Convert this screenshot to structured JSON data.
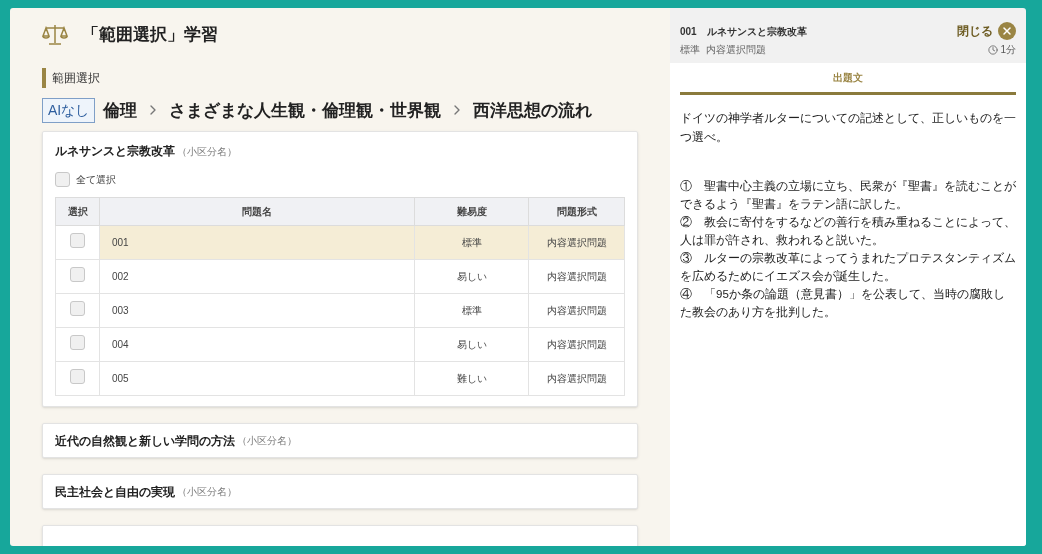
{
  "header": {
    "title": "「範囲選択」学習"
  },
  "section_label": "範囲選択",
  "breadcrumb": {
    "badge": "AIなし",
    "items": [
      "倫理",
      "さまざまな人生観・倫理観・世界観",
      "西洋思想の流れ"
    ]
  },
  "units": [
    {
      "title": "ルネサンスと宗教改革",
      "note": "（小区分名）",
      "expanded": true,
      "select_all": {
        "label": "全て選択",
        "checked": false
      },
      "table": {
        "columns": [
          "選択",
          "問題名",
          "難易度",
          "問題形式"
        ],
        "rows": [
          {
            "checked": false,
            "selected": true,
            "name": "001",
            "difficulty": "標準",
            "format": "内容選択問題"
          },
          {
            "checked": false,
            "selected": false,
            "name": "002",
            "difficulty": "易しい",
            "format": "内容選択問題"
          },
          {
            "checked": false,
            "selected": false,
            "name": "003",
            "difficulty": "標準",
            "format": "内容選択問題"
          },
          {
            "checked": false,
            "selected": false,
            "name": "004",
            "difficulty": "易しい",
            "format": "内容選択問題"
          },
          {
            "checked": false,
            "selected": false,
            "name": "005",
            "difficulty": "難しい",
            "format": "内容選択問題"
          }
        ]
      }
    },
    {
      "title": "近代の自然観と新しい学問の方法",
      "note": "（小区分名）",
      "expanded": false
    },
    {
      "title": "民主社会と自由の実現",
      "note": "（小区分名）",
      "expanded": false
    },
    {
      "expanded": false
    }
  ],
  "panel": {
    "number": "001",
    "title": "ルネサンスと宗教改革",
    "close_label": "閉じる",
    "difficulty": "標準",
    "format": "内容選択問題",
    "time": "1分",
    "tabs": [
      {
        "label": "出題文",
        "selected": true
      }
    ],
    "question": "ドイツの神学者ルターについての記述として、正しいものを一つ選べ。",
    "choices": [
      "①　聖書中心主義の立場に立ち、民衆が『聖書』を読むことができるよう『聖書』をラテン語に訳した。",
      "②　教会に寄付をするなどの善行を積み重ねることによって、人は罪が許され、救われると説いた。",
      "③　ルターの宗教改革によってうまれたプロテスタンティズムを広めるためにイエズス会が誕生した。",
      "④　「95か条の論題（意見書）」を公表して、当時の腐敗した教会のあり方を批判した。"
    ]
  }
}
